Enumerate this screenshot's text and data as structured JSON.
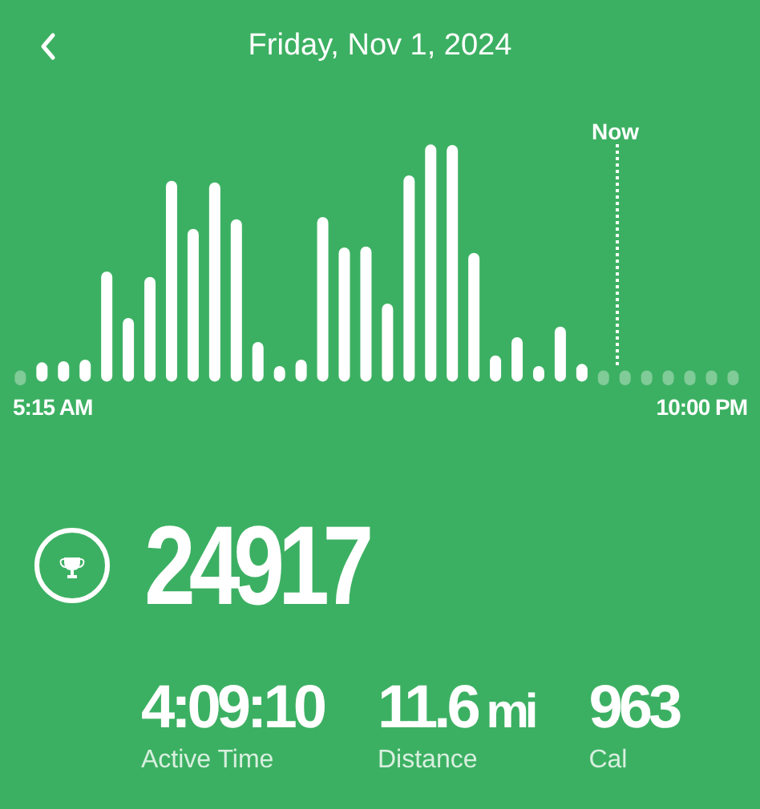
{
  "header": {
    "title": "Friday, Nov 1, 2024"
  },
  "activity": {
    "now_label": "Now",
    "start_label": "5:15 AM",
    "end_label": "10:00 PM"
  },
  "steps": {
    "value": "24917"
  },
  "stats": [
    {
      "value": "4:09:10",
      "label": "Active Time"
    },
    {
      "value": "11.6",
      "unit": "mi",
      "label": "Distance"
    },
    {
      "value": "963",
      "label": "Cal"
    }
  ]
}
